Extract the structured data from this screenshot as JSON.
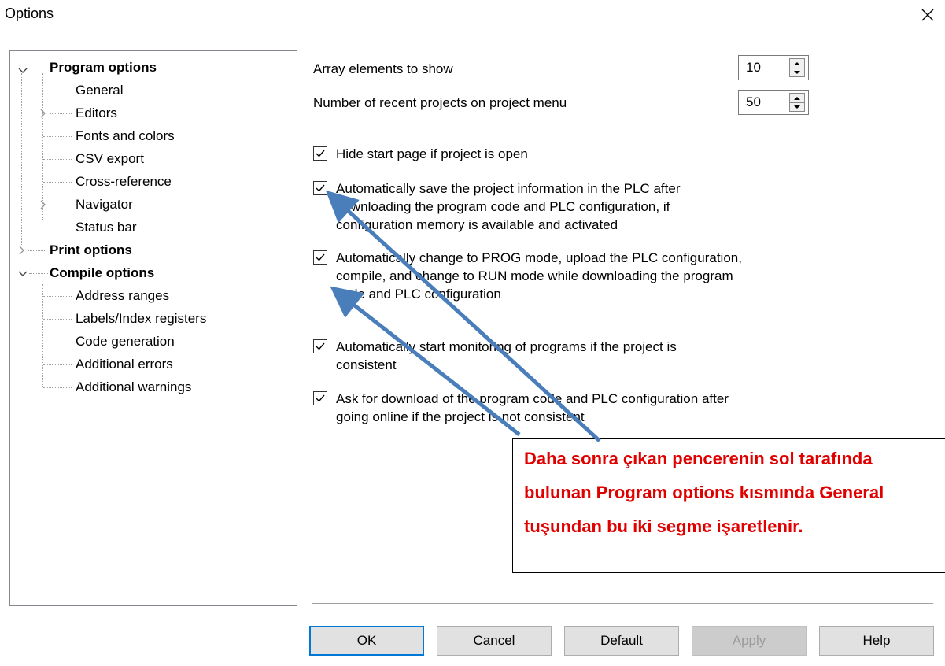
{
  "window": {
    "title": "Options"
  },
  "tree": {
    "items": [
      {
        "label": "Program options"
      },
      {
        "label": "General"
      },
      {
        "label": "Editors"
      },
      {
        "label": "Fonts and colors"
      },
      {
        "label": "CSV export"
      },
      {
        "label": "Cross-reference"
      },
      {
        "label": "Navigator"
      },
      {
        "label": "Status bar"
      },
      {
        "label": "Print options"
      },
      {
        "label": "Compile options"
      },
      {
        "label": "Address ranges"
      },
      {
        "label": "Labels/Index registers"
      },
      {
        "label": "Code generation"
      },
      {
        "label": "Additional errors"
      },
      {
        "label": "Additional warnings"
      }
    ],
    "selected": "General"
  },
  "general": {
    "array_elements_label": "Array elements to show",
    "array_elements_value": "10",
    "recent_projects_label": "Number of recent projects on project menu",
    "recent_projects_value": "50",
    "checkboxes": [
      {
        "lines": [
          "Hide start page if project is open"
        ],
        "checked": true
      },
      {
        "lines": [
          "Automatically save the project information in the PLC after",
          "downloading the program code and PLC configuration, if",
          "configuration memory is available and activated"
        ],
        "checked": true
      },
      {
        "lines": [
          "Automatically change to PROG mode, upload the PLC configuration,",
          "compile, and change to RUN mode while downloading the program",
          "code and PLC configuration"
        ],
        "checked": true
      },
      {
        "lines": [
          "Automatically start monitoring of programs if the project is",
          "consistent"
        ],
        "checked": true
      },
      {
        "lines": [
          "Ask for download of the program code and PLC configuration after",
          "going online if the project is not consistent"
        ],
        "checked": true
      }
    ]
  },
  "buttons": {
    "ok": "OK",
    "cancel": "Cancel",
    "default": "Default",
    "apply": "Apply",
    "help": "Help"
  },
  "annotation": {
    "lines": [
      "Daha sonra çıkan pencerenin sol tarafında",
      "bulunan Program options kısmında General",
      "tuşundan bu iki segme işaretlenir."
    ],
    "text_color": "#e00000",
    "arrow_color": "#4a7ebb"
  },
  "icons": [
    "close-icon",
    "chevron-down-icon",
    "chevron-right-icon",
    "spin-up-icon",
    "spin-down-icon",
    "checkmark-icon"
  ]
}
